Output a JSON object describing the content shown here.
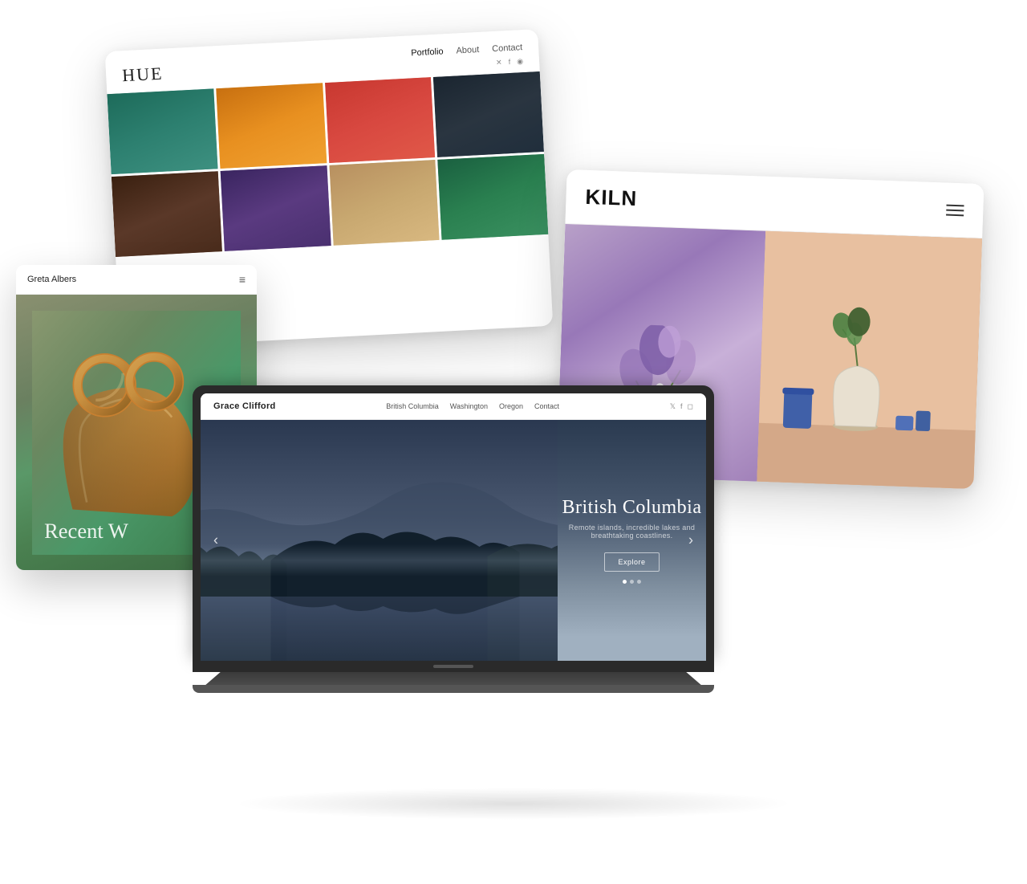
{
  "hue": {
    "logo": "HUE",
    "nav": {
      "portfolio": "Portfolio",
      "about": "About",
      "contact": "Contact"
    },
    "social": [
      "𝕏",
      "f",
      "◉"
    ]
  },
  "kiln": {
    "logo": "KILN",
    "menu_label": "menu"
  },
  "greta": {
    "brand": "Greta Albers",
    "hero_text": "Recent W"
  },
  "grace": {
    "brand": "Grace Clifford",
    "nav": {
      "bc": "British Columbia",
      "wa": "Washington",
      "or": "Oregon",
      "contact": "Contact"
    },
    "social": [
      "𝕏",
      "f",
      "◻"
    ],
    "hero": {
      "title": "British Columbia",
      "subtitle": "Remote islands, incredible lakes and breathtaking coastlines.",
      "explore_btn": "Explore",
      "arrow_left": "‹",
      "arrow_right": "›"
    },
    "dots": [
      true,
      false,
      false
    ]
  }
}
